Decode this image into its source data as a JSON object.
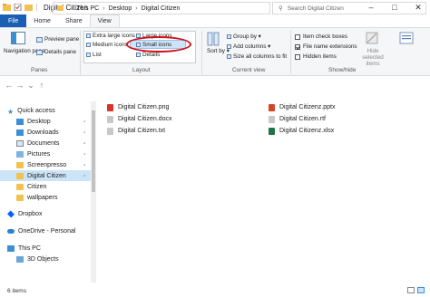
{
  "window": {
    "title": "Digital Citizen"
  },
  "tabs": [
    {
      "label": "File"
    },
    {
      "label": "Home"
    },
    {
      "label": "Share"
    },
    {
      "label": "View"
    }
  ],
  "ribbon": {
    "panes": {
      "navigation_pane": "Navigation pane",
      "preview_pane": "Preview pane",
      "details_pane": "Details pane",
      "group": "Panes"
    },
    "layout": {
      "extra_large_icons": "Extra large icons",
      "large_icons": "Large icons",
      "medium_icons": "Medium icons",
      "small_icons": "Small icons",
      "list": "List",
      "details": "Details",
      "group": "Layout"
    },
    "current_view": {
      "sort_by": "Sort by",
      "group_by": "Group by",
      "add_columns": "Add columns",
      "size_all_columns": "Size all columns to fit",
      "group": "Current view"
    },
    "show_hide": {
      "item_check_boxes": "Item check boxes",
      "file_name_extensions": "File name extensions",
      "hidden_items": "Hidden items",
      "hide_selected": "Hide selected items",
      "group": "Show/hide",
      "item_check_boxes_checked": false,
      "file_name_extensions_checked": true,
      "hidden_items_checked": false
    }
  },
  "address": {
    "crumbs": [
      "This PC",
      "Desktop",
      "Digital Citizen"
    ],
    "search_placeholder": "Search Digital Citizen"
  },
  "nav": {
    "items": [
      {
        "label": "Quick access",
        "icon": "star-icon"
      },
      {
        "label": "Desktop",
        "icon": "desktop-icon"
      },
      {
        "label": "Downloads",
        "icon": "download-icon"
      },
      {
        "label": "Documents",
        "icon": "documents-icon"
      },
      {
        "label": "Pictures",
        "icon": "pictures-icon"
      },
      {
        "label": "Screenpresso",
        "icon": "folder-icon"
      },
      {
        "label": "Digital Citizen",
        "icon": "folder-icon"
      },
      {
        "label": "Citizen",
        "icon": "folder-icon"
      },
      {
        "label": "wallpapers",
        "icon": "folder-icon"
      },
      {
        "label": "Dropbox",
        "icon": "dropbox-icon"
      },
      {
        "label": "OneDrive - Personal",
        "icon": "onedrive-icon"
      },
      {
        "label": "This PC",
        "icon": "pc-icon"
      },
      {
        "label": "3D Objects",
        "icon": "3d-objects-icon"
      }
    ]
  },
  "files": [
    {
      "name": "Digital Citizen.png",
      "color": "#d9342b"
    },
    {
      "name": "Digital Citizen.docx",
      "color": "#c8c8c8"
    },
    {
      "name": "Digital Citizen.txt",
      "color": "#c8c8c8"
    },
    {
      "name": "Digital Citizenz.pptx",
      "color": "#d24726"
    },
    {
      "name": "Digital Citizen.rtf",
      "color": "#c8c8c8"
    },
    {
      "name": "Digital Citizenz.xlsx",
      "color": "#217346"
    }
  ],
  "status": {
    "count": "6 items"
  },
  "colors": {
    "accent": "#1a5fb4",
    "selection": "#cce4f7",
    "annotation": "#d0121b"
  }
}
